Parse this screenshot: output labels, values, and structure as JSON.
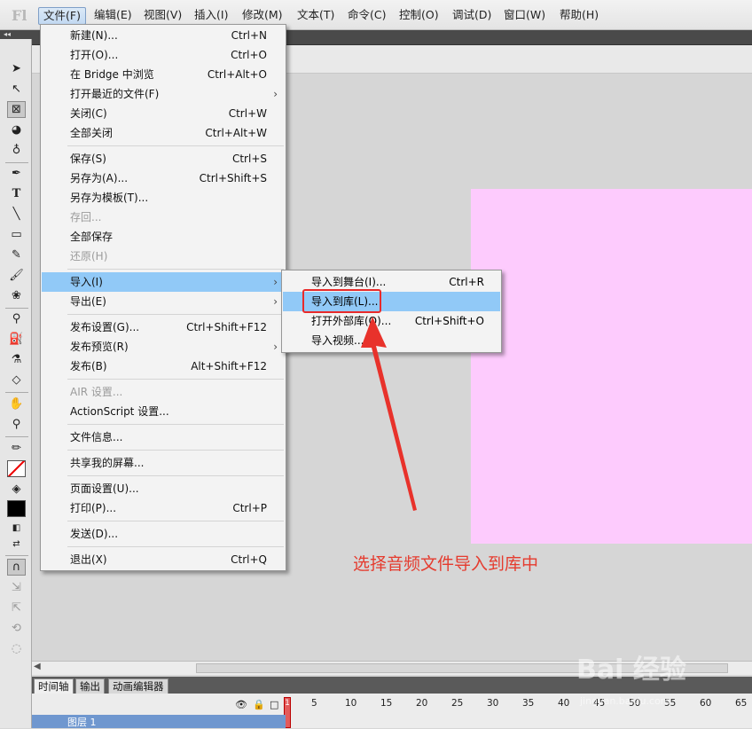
{
  "app": {
    "logo": "Fl"
  },
  "menubar": {
    "items": [
      "文件(F)",
      "编辑(E)",
      "视图(V)",
      "插入(I)",
      "修改(M)",
      "文本(T)",
      "命令(C)",
      "控制(O)",
      "调试(D)",
      "窗口(W)",
      "帮助(H)"
    ],
    "active_index": 0
  },
  "tools": {
    "header": "◂◂"
  },
  "file_menu": {
    "items": [
      {
        "label": "新建(N)...",
        "shortcut": "Ctrl+N"
      },
      {
        "label": "打开(O)...",
        "shortcut": "Ctrl+O"
      },
      {
        "label": "在 Bridge 中浏览",
        "shortcut": "Ctrl+Alt+O"
      },
      {
        "label": "打开最近的文件(F)",
        "shortcut": "",
        "submenu": true
      },
      {
        "label": "关闭(C)",
        "shortcut": "Ctrl+W"
      },
      {
        "label": "全部关闭",
        "shortcut": "Ctrl+Alt+W"
      },
      {
        "label": "保存(S)",
        "shortcut": "Ctrl+S"
      },
      {
        "label": "另存为(A)...",
        "shortcut": "Ctrl+Shift+S"
      },
      {
        "label": "另存为模板(T)...",
        "shortcut": ""
      },
      {
        "label": "存回...",
        "shortcut": "",
        "disabled": true
      },
      {
        "label": "全部保存",
        "shortcut": ""
      },
      {
        "label": "还原(H)",
        "shortcut": "",
        "disabled": true
      },
      {
        "label": "导入(I)",
        "shortcut": "",
        "submenu": true,
        "highlighted": true
      },
      {
        "label": "导出(E)",
        "shortcut": "",
        "submenu": true
      },
      {
        "label": "发布设置(G)...",
        "shortcut": "Ctrl+Shift+F12"
      },
      {
        "label": "发布预览(R)",
        "shortcut": "",
        "submenu": true
      },
      {
        "label": "发布(B)",
        "shortcut": "Alt+Shift+F12"
      },
      {
        "label": "AIR 设置...",
        "shortcut": "",
        "disabled": true
      },
      {
        "label": "ActionScript 设置...",
        "shortcut": ""
      },
      {
        "label": "文件信息...",
        "shortcut": ""
      },
      {
        "label": "共享我的屏幕...",
        "shortcut": ""
      },
      {
        "label": "页面设置(U)...",
        "shortcut": ""
      },
      {
        "label": "打印(P)...",
        "shortcut": "Ctrl+P"
      },
      {
        "label": "发送(D)...",
        "shortcut": ""
      },
      {
        "label": "退出(X)",
        "shortcut": "Ctrl+Q"
      }
    ]
  },
  "import_submenu": {
    "items": [
      {
        "label": "导入到舞台(I)...",
        "shortcut": "Ctrl+R"
      },
      {
        "label": "导入到库(L)...",
        "shortcut": "",
        "highlighted": true
      },
      {
        "label": "打开外部库(O)...",
        "shortcut": "Ctrl+Shift+O"
      },
      {
        "label": "导入视频...",
        "shortcut": ""
      }
    ]
  },
  "annotation": {
    "text": "选择音频文件导入到库中",
    "color": "#e53b2e"
  },
  "timeline": {
    "tabs": [
      "时间轴",
      "输出",
      "动画编辑器"
    ],
    "frame_numbers": [
      "1",
      "5",
      "10",
      "15",
      "20",
      "25",
      "30",
      "35",
      "40",
      "45",
      "50",
      "55",
      "60",
      "65"
    ],
    "layer_name": "图层 1"
  },
  "watermark": {
    "text": "Bai 经验",
    "url": "jingyan.baidu.com"
  },
  "colors": {
    "stage": "#fdcbfd",
    "highlight": "#91c9f7",
    "annotation": "#e53b2e"
  }
}
